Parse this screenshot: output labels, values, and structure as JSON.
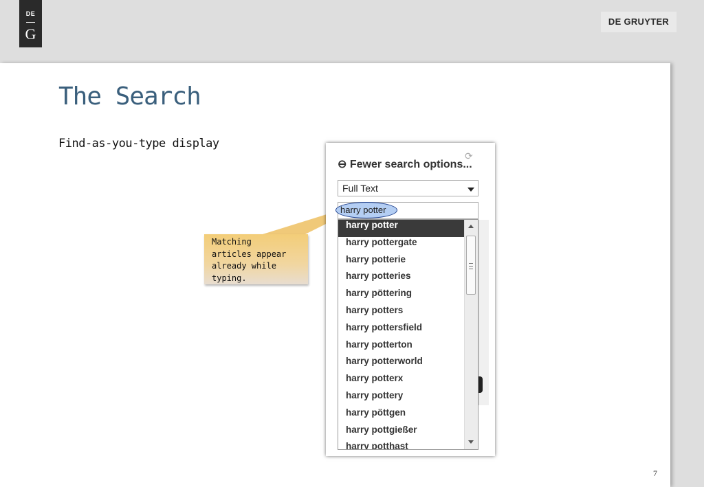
{
  "branding": {
    "logo_top": "DE",
    "logo_bottom": "G",
    "publisher": "DE GRUYTER"
  },
  "slide": {
    "title": "The Search",
    "subtitle": "Find-as-you-type display",
    "page_number": "7"
  },
  "callout": {
    "lines": [
      "Matching",
      "articles appear",
      "already while",
      "typing."
    ]
  },
  "search_panel": {
    "toggle_label": "⊖ Fewer search options...",
    "field_select": "Full Text",
    "query": "harry potter",
    "suggestions": [
      "harry potter",
      "harry pottergate",
      "harry potterie",
      "harry potteries",
      "harry pöttering",
      "harry potters",
      "harry pottersfield",
      "harry potterton",
      "harry potterworld",
      "harry potterx",
      "harry pottery",
      "harry pöttgen",
      "harry pottgießer",
      "harry potthast"
    ],
    "active_index": 0
  },
  "colors": {
    "title": "#3a5f7c",
    "callout": "#f3cd78",
    "query_highlight": "#b4cef3",
    "active_suggestion": "#3a3a3a"
  }
}
